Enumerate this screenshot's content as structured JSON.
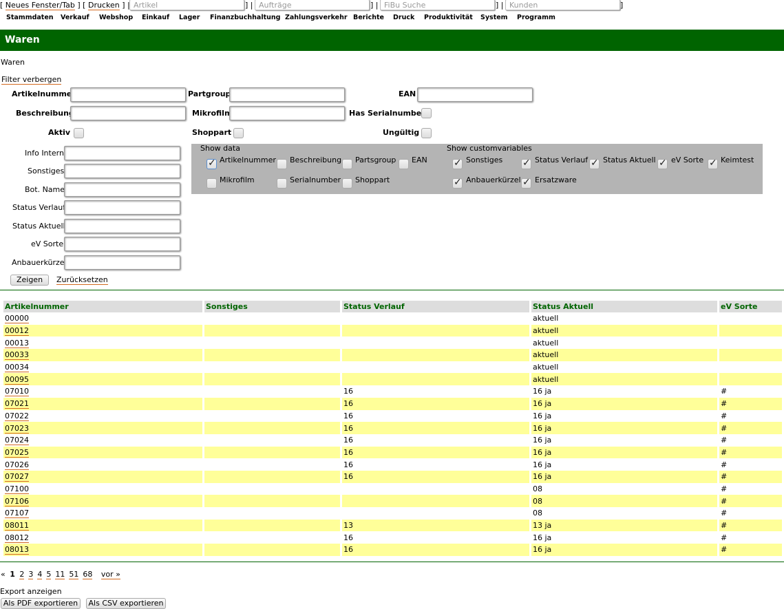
{
  "topbar": {
    "new_window": "Neues Fenster/Tab",
    "print": "Drucken",
    "search_article": "Artikel",
    "search_orders": "Aufträge",
    "search_fibu": "FiBu Suche",
    "search_customers": "Kunden"
  },
  "menu": [
    "Stammdaten",
    "Verkauf",
    "Webshop",
    "Einkauf",
    "Lager",
    "Finanzbuchhaltung",
    "Zahlungsverkehr",
    "Berichte",
    "Druck",
    "Produktivität",
    "System",
    "Programm"
  ],
  "header_title": "Waren",
  "breadcrumb": "Waren",
  "filter_toggle": "Filter verbergen",
  "filters": {
    "artikelnummer": "Artikelnummer",
    "partgroup": "Partgroup",
    "ean": "EAN",
    "beschreibung": "Beschreibung",
    "mikrofilm": "Mikrofilm",
    "has_serialnumber": "Has Serialnumber",
    "aktiv": "Aktiv",
    "shoppart": "Shoppart",
    "ungueltig": "Ungültig",
    "info_intern": "Info Intern",
    "sonstiges": "Sonstiges",
    "bot_name": "Bot. Name",
    "status_verlauf": "Status Verlauf",
    "status_aktuell": "Status Aktuell",
    "ev_sorte": "eV Sorte",
    "anbauerkuerzel": "Anbauerkürzel"
  },
  "show_data": {
    "title": "Show data",
    "items": [
      {
        "label": "Artikelnummer",
        "checked": true
      },
      {
        "label": "Beschreibung",
        "checked": false
      },
      {
        "label": "Partsgroup",
        "checked": false
      },
      {
        "label": "EAN",
        "checked": false
      },
      {
        "label": "Mikrofilm",
        "checked": false
      },
      {
        "label": "Serialnumber",
        "checked": false
      },
      {
        "label": "Shoppart",
        "checked": false
      }
    ]
  },
  "show_custom": {
    "title": "Show customvariables",
    "items": [
      {
        "label": "Sonstiges",
        "checked": true
      },
      {
        "label": "Status Verlauf",
        "checked": true
      },
      {
        "label": "Status Aktuell",
        "checked": true
      },
      {
        "label": "eV Sorte",
        "checked": true
      },
      {
        "label": "Keimtest",
        "checked": true
      },
      {
        "label": "Anbauerkürzel",
        "checked": true
      },
      {
        "label": "Ersatzware",
        "checked": true
      }
    ]
  },
  "buttons": {
    "show": "Zeigen",
    "reset": "Zurücksetzen"
  },
  "table": {
    "columns": [
      "Artikelnummer",
      "Sonstiges",
      "Status Verlauf",
      "Status Aktuell",
      "eV Sorte"
    ],
    "rows": [
      [
        "00000",
        "",
        "",
        "aktuell",
        ""
      ],
      [
        "00012",
        "",
        "",
        "aktuell",
        ""
      ],
      [
        "00013",
        "",
        "",
        "aktuell",
        ""
      ],
      [
        "00033",
        "",
        "",
        "aktuell",
        ""
      ],
      [
        "00034",
        "",
        "",
        "aktuell",
        ""
      ],
      [
        "00095",
        "",
        "",
        "aktuell",
        ""
      ],
      [
        "07010",
        "",
        "16",
        "16 ja",
        "#"
      ],
      [
        "07021",
        "",
        "16",
        "16 ja",
        "#"
      ],
      [
        "07022",
        "",
        "16",
        "16 ja",
        "#"
      ],
      [
        "07023",
        "",
        "16",
        "16 ja",
        "#"
      ],
      [
        "07024",
        "",
        "16",
        "16 ja",
        "#"
      ],
      [
        "07025",
        "",
        "16",
        "16 ja",
        "#"
      ],
      [
        "07026",
        "",
        "16",
        "16 ja",
        "#"
      ],
      [
        "07027",
        "",
        "16",
        "16 ja",
        "#"
      ],
      [
        "07100",
        "",
        "",
        "08",
        "#"
      ],
      [
        "07106",
        "",
        "",
        "08",
        "#"
      ],
      [
        "07107",
        "",
        "",
        "08",
        "#"
      ],
      [
        "08011",
        "",
        "13",
        "13 ja",
        "#"
      ],
      [
        "08012",
        "",
        "16",
        "16 ja",
        "#"
      ],
      [
        "08013",
        "",
        "16",
        "16 ja",
        "#"
      ]
    ]
  },
  "pager": {
    "prev": "«",
    "current": "1",
    "pages": [
      "2",
      "3",
      "4",
      "5",
      "11",
      "51",
      "68"
    ],
    "next": "vor »"
  },
  "export": {
    "title": "Export anzeigen",
    "pdf": "Als PDF exportieren",
    "csv": "Als CSV exportieren"
  }
}
